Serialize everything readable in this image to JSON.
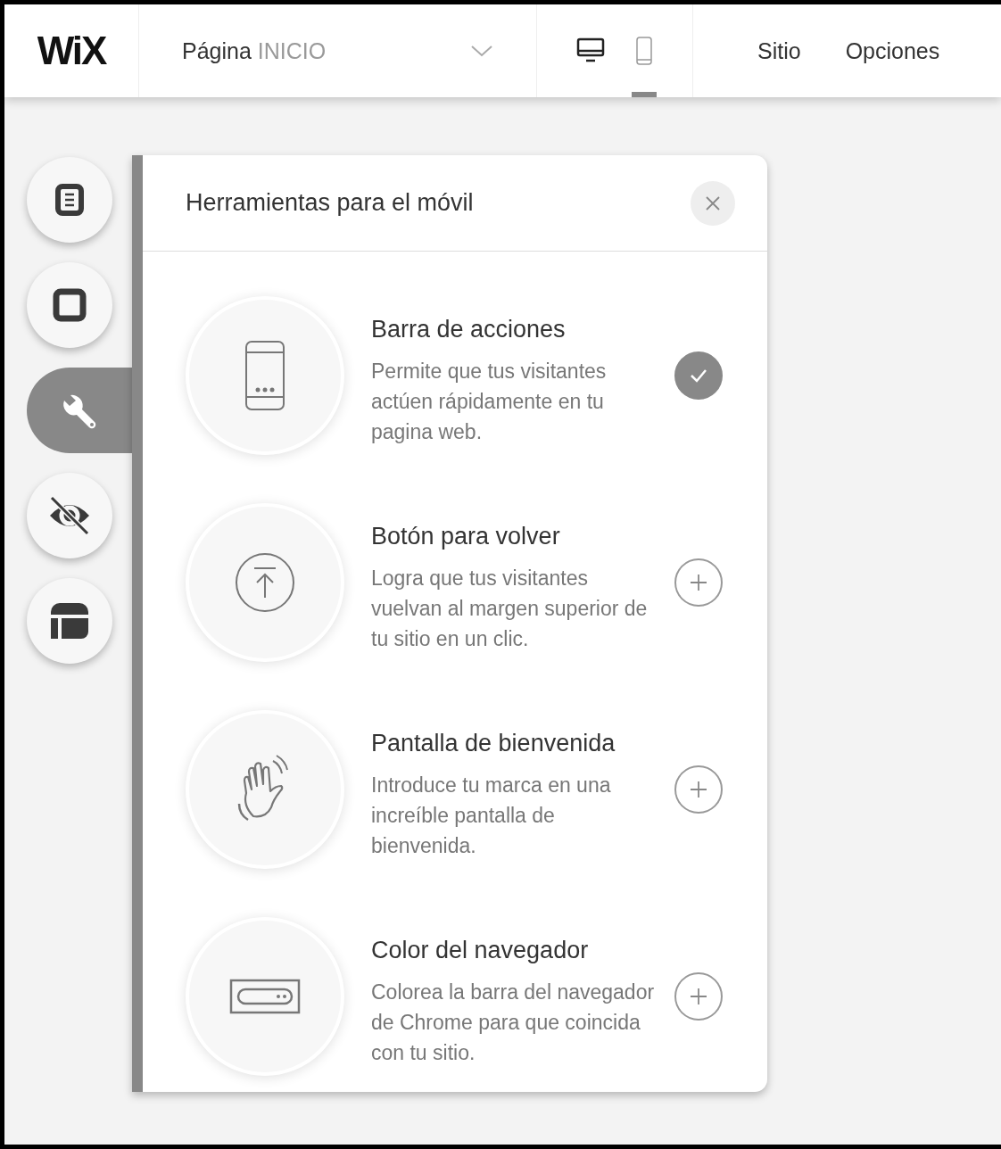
{
  "topbar": {
    "logo": "WiX",
    "page_selector": {
      "label": "Página",
      "value": "INICIO"
    },
    "devices": [
      {
        "kind": "desktop",
        "selected": false
      },
      {
        "kind": "mobile",
        "selected": true
      }
    ],
    "menu": [
      "Sitio",
      "Opciones"
    ]
  },
  "rail": [
    {
      "kind": "pages",
      "selected": false
    },
    {
      "kind": "background",
      "selected": false
    },
    {
      "kind": "tools",
      "selected": true
    },
    {
      "kind": "hidden",
      "selected": false
    },
    {
      "kind": "layout",
      "selected": false
    }
  ],
  "panel": {
    "title": "Herramientas para el móvil",
    "items": [
      {
        "kind": "action-bar",
        "title": "Barra de acciones",
        "description": "Permite que tus visitantes actúen rápidamente en tu pagina web.",
        "added": true
      },
      {
        "kind": "back-to-top",
        "title": "Botón para volver",
        "description": "Logra que tus visitantes vuelvan al margen superior de tu sitio en un clic.",
        "added": false
      },
      {
        "kind": "welcome",
        "title": "Pantalla de bienvenida",
        "description": "Introduce tu marca en una increíble pantalla de bienvenida.",
        "added": false
      },
      {
        "kind": "browser-color",
        "title": "Color del navegador",
        "description": "Colorea la barra del navegador de Chrome para que coincida con tu sitio.",
        "added": false
      }
    ]
  }
}
